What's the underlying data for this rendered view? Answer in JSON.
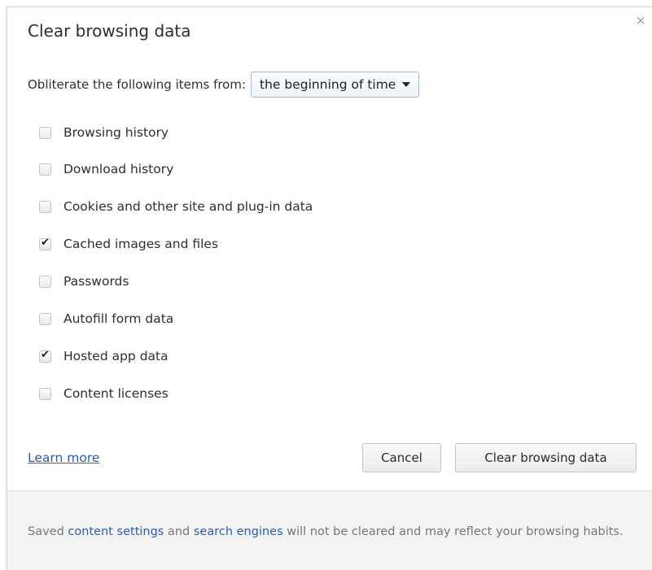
{
  "dialog": {
    "title": "Clear browsing data",
    "close_glyph": "×",
    "period_label": "Obliterate the following items from:",
    "period_value": "the beginning of time",
    "options": [
      {
        "label": "Browsing history",
        "checked": false
      },
      {
        "label": "Download history",
        "checked": false
      },
      {
        "label": "Cookies and other site and plug-in data",
        "checked": false
      },
      {
        "label": "Cached images and files",
        "checked": true
      },
      {
        "label": "Passwords",
        "checked": false
      },
      {
        "label": "Autofill form data",
        "checked": false
      },
      {
        "label": "Hosted app data",
        "checked": true
      },
      {
        "label": "Content licenses",
        "checked": false
      }
    ],
    "learn_more": "Learn more",
    "cancel_label": "Cancel",
    "clear_label": "Clear browsing data"
  },
  "footer": {
    "text_1": "Saved ",
    "link_1": "content settings",
    "text_2": " and ",
    "link_2": "search engines",
    "text_3": " will not be cleared and may reflect your browsing habits."
  },
  "icons": {
    "close": "close-icon",
    "dropdown": "caret-down-icon",
    "check": "checkmark-icon"
  },
  "colors": {
    "link": "#2a5db8",
    "footer_bg": "#f3f3f3",
    "select_border": "#aab7cc"
  }
}
